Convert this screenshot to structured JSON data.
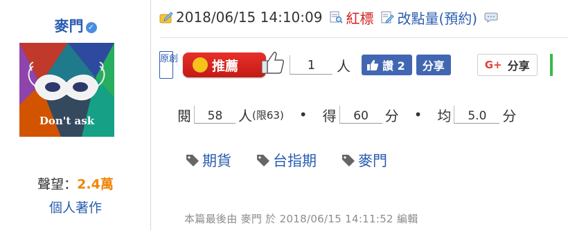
{
  "author": {
    "name": "麥門",
    "avatar_caption": "Don't ask",
    "reputation_label": "聲望：",
    "reputation_value": "2.4萬",
    "works_link": "個人著作"
  },
  "meta": {
    "timestamp": "2018/06/15 14:10:09",
    "red_label_tag": "紅標",
    "points_label": "改點量(預約)"
  },
  "actions": {
    "original_badge": "原創",
    "recommend_label": "推薦",
    "recommend_count": "1",
    "person_unit": "人",
    "fb_like_label": "讚 2",
    "fb_share_label": "分享",
    "gplus_label": "分享"
  },
  "stats": {
    "read_label": "閱",
    "read_count": "58",
    "read_unit": "人",
    "read_limit": "(限63)",
    "score_label": "得",
    "score_value": "60",
    "score_unit": "分",
    "avg_label": "均",
    "avg_value": "5.0",
    "avg_unit": "分"
  },
  "tags": [
    {
      "label": "期貨"
    },
    {
      "label": "台指期"
    },
    {
      "label": "麥門"
    }
  ],
  "edit_note": "本篇最後由 麥門 於 2018/06/15 14:11:52 編輯",
  "colors": {
    "link_blue": "#2a5db0",
    "red": "#d42020",
    "orange": "#f0860a",
    "facebook": "#4267b2"
  }
}
